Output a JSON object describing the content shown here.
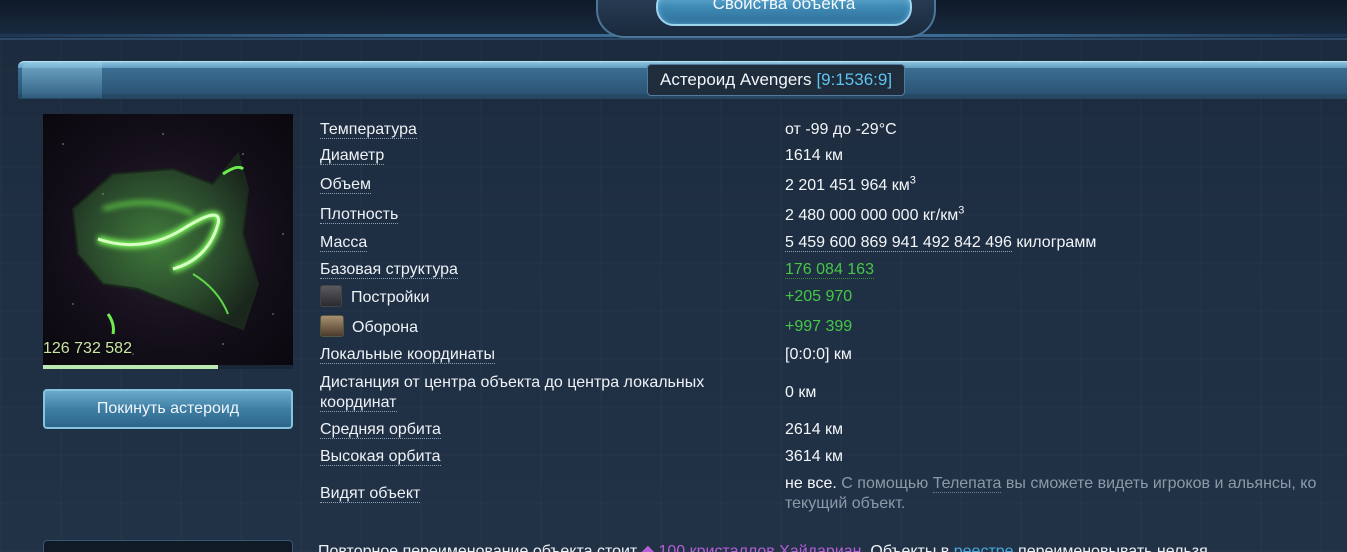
{
  "top_tab": {
    "label": "Свойства объекта"
  },
  "header": {
    "name": "Астероид Avengers",
    "coords": "[9:1536:9]"
  },
  "asteroid": {
    "count": "126 732 582",
    "progress_fraction": 0.7,
    "leave_button": "Покинуть астероид"
  },
  "properties": [
    {
      "label": "Температура",
      "value": "от -99 до -29°C"
    },
    {
      "label": "Диаметр",
      "value": "1614 км"
    },
    {
      "label": "Объем",
      "value": "2 201 451 964 км",
      "value_sup": "3"
    },
    {
      "label": "Плотность",
      "value": "2 480 000 000 000 кг/км",
      "value_sup": "3"
    },
    {
      "label": "Масса",
      "value": "5 459 600 869 941 492 842 496",
      "value_suffix": " килограмм"
    },
    {
      "label": "Базовая структура",
      "value": "176 084 163"
    },
    {
      "label": "Постройки",
      "value": "+205 970",
      "icon": "building-icon"
    },
    {
      "label": "Оборона",
      "value": "+997 399",
      "icon": "defense-icon"
    },
    {
      "label": "Локальные координаты",
      "value": "[0:0:0] км"
    },
    {
      "label_line1": "Дистанция от центра объекта до центра локальных",
      "label_line2": "координат",
      "value": "0 км"
    },
    {
      "label": "Средняя орбита",
      "value": "2614 км"
    },
    {
      "label": "Высокая орбита",
      "value": "3614 км"
    },
    {
      "label": "Видят объект",
      "value": "не все.",
      "note_pre": " С помощью ",
      "note_link": "Телепата",
      "note_post": " вы сможете видеть игроков и альянсы, ко",
      "note_line2": "текущий объект."
    }
  ],
  "rename": {
    "pre": "Повторное переименование объекта стоит ",
    "cost": "100 кристаллов Хайдариан",
    "mid": ". Объекты в ",
    "link": "реестре",
    "post": " переименовывать нельзя."
  },
  "colors": {
    "value_green": "#46c846",
    "coords_blue": "#5fc3ef",
    "crystal_purple": "#b55fd9"
  }
}
